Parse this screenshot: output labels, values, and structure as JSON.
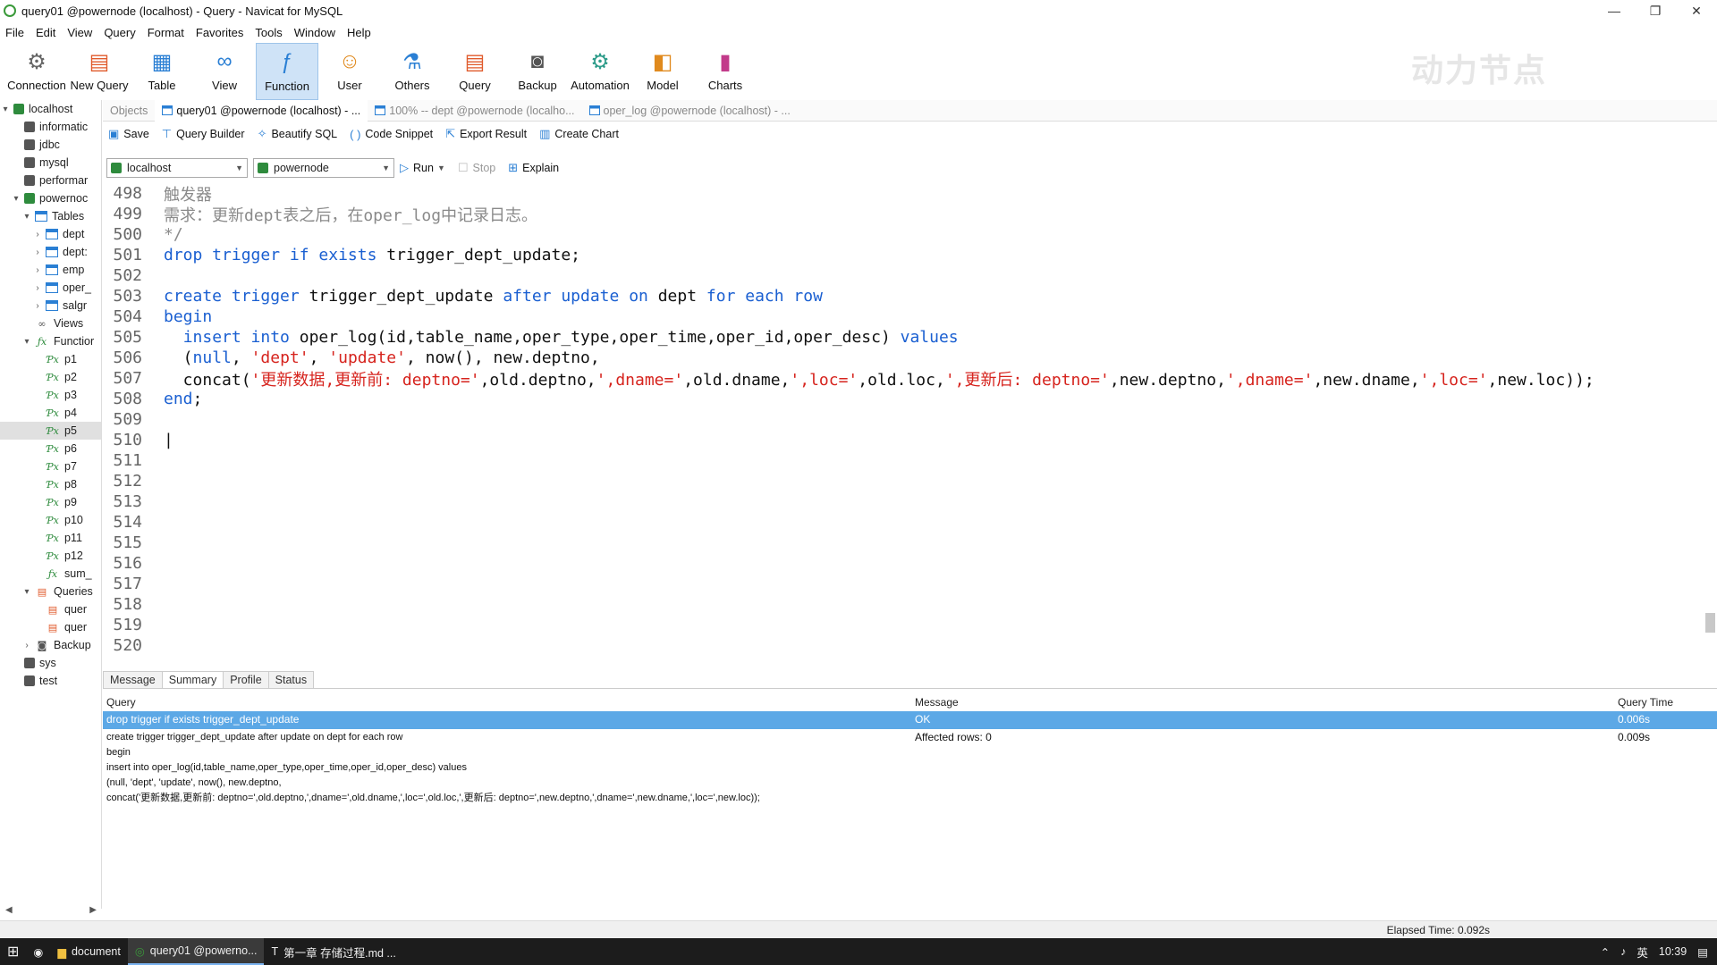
{
  "window": {
    "title": "query01 @powernode (localhost) - Query - Navicat for MySQL",
    "controls": [
      "—",
      "❐",
      "✕"
    ]
  },
  "menu": [
    "File",
    "Edit",
    "View",
    "Query",
    "Format",
    "Favorites",
    "Tools",
    "Window",
    "Help"
  ],
  "toolbar": [
    {
      "label": "Connection",
      "icon": "connection-icon"
    },
    {
      "label": "New Query",
      "icon": "new-query-icon"
    },
    {
      "label": "Table",
      "icon": "table-icon"
    },
    {
      "label": "View",
      "icon": "view-icon"
    },
    {
      "label": "Function",
      "icon": "function-icon",
      "active": true
    },
    {
      "label": "User",
      "icon": "user-icon"
    },
    {
      "label": "Others",
      "icon": "others-icon"
    },
    {
      "label": "Query",
      "icon": "query-icon"
    },
    {
      "label": "Backup",
      "icon": "backup-icon"
    },
    {
      "label": "Automation",
      "icon": "automation-icon"
    },
    {
      "label": "Model",
      "icon": "model-icon"
    },
    {
      "label": "Charts",
      "icon": "charts-icon"
    }
  ],
  "watermark": "动力节点",
  "tree": [
    {
      "label": "localhost",
      "level": 0,
      "icon": "connection",
      "exp": "▾"
    },
    {
      "label": "informatic",
      "level": 1,
      "icon": "db"
    },
    {
      "label": "jdbc",
      "level": 1,
      "icon": "db"
    },
    {
      "label": "mysql",
      "level": 1,
      "icon": "db"
    },
    {
      "label": "performar",
      "level": 1,
      "icon": "db"
    },
    {
      "label": "powernoc",
      "level": 1,
      "icon": "db-open",
      "exp": "▾"
    },
    {
      "label": "Tables",
      "level": 2,
      "icon": "table",
      "exp": "▾"
    },
    {
      "label": "dept",
      "level": 3,
      "icon": "table",
      "exp": "›"
    },
    {
      "label": "dept:",
      "level": 3,
      "icon": "table",
      "exp": "›"
    },
    {
      "label": "emp",
      "level": 3,
      "icon": "table",
      "exp": "›"
    },
    {
      "label": "oper_",
      "level": 3,
      "icon": "table",
      "exp": "›"
    },
    {
      "label": "salgr",
      "level": 3,
      "icon": "table",
      "exp": "›"
    },
    {
      "label": "Views",
      "level": 2,
      "icon": "view"
    },
    {
      "label": "Functior",
      "level": 2,
      "icon": "fx",
      "exp": "▾"
    },
    {
      "label": "p1",
      "level": 3,
      "icon": "proc"
    },
    {
      "label": "p2",
      "level": 3,
      "icon": "proc"
    },
    {
      "label": "p3",
      "level": 3,
      "icon": "proc"
    },
    {
      "label": "p4",
      "level": 3,
      "icon": "proc"
    },
    {
      "label": "p5",
      "level": 3,
      "icon": "proc",
      "selected": true
    },
    {
      "label": "p6",
      "level": 3,
      "icon": "proc"
    },
    {
      "label": "p7",
      "level": 3,
      "icon": "proc"
    },
    {
      "label": "p8",
      "level": 3,
      "icon": "proc"
    },
    {
      "label": "p9",
      "level": 3,
      "icon": "proc"
    },
    {
      "label": "p10",
      "level": 3,
      "icon": "proc"
    },
    {
      "label": "p11",
      "level": 3,
      "icon": "proc"
    },
    {
      "label": "p12",
      "level": 3,
      "icon": "proc"
    },
    {
      "label": "sum_",
      "level": 3,
      "icon": "fx"
    },
    {
      "label": "Queries",
      "level": 2,
      "icon": "query",
      "exp": "▾"
    },
    {
      "label": "quer",
      "level": 3,
      "icon": "query"
    },
    {
      "label": "quer",
      "level": 3,
      "icon": "query"
    },
    {
      "label": "Backup",
      "level": 2,
      "icon": "backup",
      "exp": "›"
    },
    {
      "label": "sys",
      "level": 1,
      "icon": "db"
    },
    {
      "label": "test",
      "level": 1,
      "icon": "db"
    }
  ],
  "tabs": [
    {
      "label": "Objects",
      "icon": false
    },
    {
      "label": "query01 @powernode (localhost) - ...",
      "icon": true,
      "active": true
    },
    {
      "label": "100% -- dept @powernode (localho...",
      "icon": true
    },
    {
      "label": "oper_log @powernode (localhost) - ...",
      "icon": true
    }
  ],
  "query_toolbar": [
    {
      "label": "Save",
      "icon": "save-icon",
      "glyph": "▣"
    },
    {
      "label": "Query Builder",
      "icon": "query-builder-icon",
      "glyph": "⊤"
    },
    {
      "label": "Beautify SQL",
      "icon": "beautify-icon",
      "glyph": "✧"
    },
    {
      "label": "Code Snippet",
      "icon": "code-snippet-icon",
      "glyph": "( )"
    },
    {
      "label": "Export Result",
      "icon": "export-icon",
      "glyph": "⇱"
    },
    {
      "label": "Create Chart",
      "icon": "chart-icon",
      "glyph": "▥"
    }
  ],
  "connection_select": "localhost",
  "database_select": "powernode",
  "run_label": "Run",
  "stop_label": "Stop",
  "explain_label": "Explain",
  "code_lines": [
    {
      "n": "498",
      "segs": [
        [
          "cm",
          "触发器"
        ]
      ]
    },
    {
      "n": "499",
      "segs": [
        [
          "cm",
          "需求：更新dept表之后，在oper_log中记录日志。"
        ]
      ]
    },
    {
      "n": "500",
      "segs": [
        [
          "cm",
          "*/"
        ]
      ]
    },
    {
      "n": "501",
      "segs": [
        [
          "kw",
          "drop trigger if exists "
        ],
        [
          "",
          "trigger_dept_update;"
        ]
      ]
    },
    {
      "n": "502",
      "segs": []
    },
    {
      "n": "503",
      "segs": [
        [
          "kw",
          "create trigger "
        ],
        [
          "",
          "trigger_dept_update "
        ],
        [
          "kw",
          "after update on "
        ],
        [
          "",
          "dept "
        ],
        [
          "kw",
          "for each row"
        ]
      ]
    },
    {
      "n": "504",
      "segs": [
        [
          "kw",
          "begin"
        ]
      ]
    },
    {
      "n": "505",
      "segs": [
        [
          "",
          "  "
        ],
        [
          "kw",
          "insert into "
        ],
        [
          "",
          "oper_log(id,table_name,oper_type,oper_time,oper_id,oper_desc) "
        ],
        [
          "kw",
          "values"
        ]
      ]
    },
    {
      "n": "506",
      "segs": [
        [
          "",
          "  ("
        ],
        [
          "kw",
          "null"
        ],
        [
          "",
          ", "
        ],
        [
          "str",
          "'dept'"
        ],
        [
          "",
          ", "
        ],
        [
          "str",
          "'update'"
        ],
        [
          "",
          ", now(), new.deptno,"
        ]
      ]
    },
    {
      "n": "507",
      "segs": [
        [
          "",
          "  concat("
        ],
        [
          "str",
          "'更新数据,更新前: deptno='"
        ],
        [
          "",
          ",old.deptno,"
        ],
        [
          "str",
          "',dname='"
        ],
        [
          "",
          ",old.dname,"
        ],
        [
          "str",
          "',loc='"
        ],
        [
          "",
          ",old.loc,"
        ],
        [
          "str",
          "',更新后: deptno='"
        ],
        [
          "",
          ",new.deptno,"
        ],
        [
          "str",
          "',dname='"
        ],
        [
          "",
          ",new.dname,"
        ],
        [
          "str",
          "',loc='"
        ],
        [
          "",
          ",new.loc));"
        ]
      ]
    },
    {
      "n": "508",
      "segs": [
        [
          "kw",
          "end"
        ],
        [
          "",
          ";"
        ]
      ]
    },
    {
      "n": "509",
      "segs": []
    },
    {
      "n": "510",
      "segs": [
        [
          "",
          "|"
        ]
      ]
    },
    {
      "n": "511",
      "segs": []
    },
    {
      "n": "512",
      "segs": []
    },
    {
      "n": "513",
      "segs": []
    },
    {
      "n": "514",
      "segs": []
    },
    {
      "n": "515",
      "segs": []
    },
    {
      "n": "516",
      "segs": []
    },
    {
      "n": "517",
      "segs": []
    },
    {
      "n": "518",
      "segs": []
    },
    {
      "n": "519",
      "segs": []
    },
    {
      "n": "520",
      "segs": []
    }
  ],
  "result_tabs": [
    "Message",
    "Summary",
    "Profile",
    "Status"
  ],
  "active_result_tab": "Summary",
  "grid": {
    "headers": {
      "query": "Query",
      "message": "Message",
      "time": "Query Time"
    },
    "rows": [
      {
        "query": "drop trigger if exists trigger_dept_update",
        "message": "OK",
        "time": "0.006s",
        "selected": true
      },
      {
        "query": "create trigger trigger_dept_update after update on dept for each row\nbegin\ninsert into oper_log(id,table_name,oper_type,oper_time,oper_id,oper_desc) values\n(null, 'dept', 'update', now(), new.deptno,\nconcat('更新数据,更新前: deptno=',old.deptno,',dname=',old.dname,',loc=',old.loc,',更新后: deptno=',new.deptno,',dname=',new.dname,',loc=',new.loc));",
        "message": "Affected rows: 0",
        "time": "0.009s"
      }
    ]
  },
  "status": {
    "elapsed": "Elapsed Time: 0.092s"
  },
  "taskbar": {
    "items": [
      {
        "label": "document"
      },
      {
        "label": "query01 @powerno...",
        "active": true
      },
      {
        "label": "第一章 存储过程.md ..."
      }
    ],
    "ime": "英",
    "clock": "10:39"
  }
}
